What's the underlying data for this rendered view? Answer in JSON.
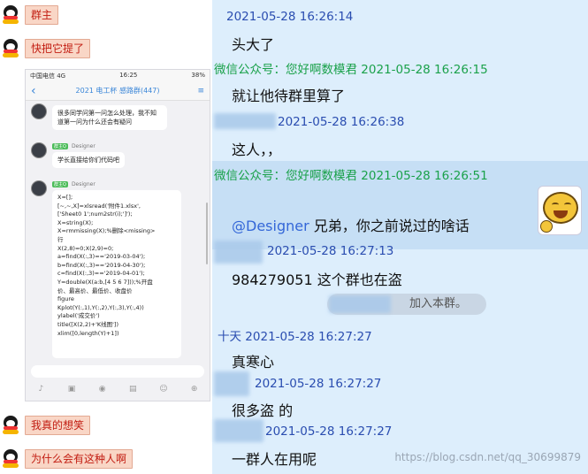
{
  "left_chat": {
    "messages": [
      {
        "text": "群主"
      },
      {
        "text": "快把它提了"
      },
      {
        "text": "我真的想笑"
      },
      {
        "text": "为什么会有这种人啊"
      }
    ]
  },
  "phone": {
    "status_left": "中国电信  4G",
    "status_time": "16:25",
    "status_right": "38%",
    "back": "‹",
    "title": "2021 电工杯 感路群(447)",
    "menu": "≡",
    "msg1": "很多同学问第一问怎么处理，我不知道第一问为什么还会有疑问",
    "msg2_tag": "群主Q",
    "msg2_name": "Designer",
    "msg2": "学长直接给你们代码吧",
    "msg3_tag": "群主Q",
    "msg3_name": "Designer",
    "code_lines": [
      "X=[];",
      "[~,~,X]=xlsread('附件1.xlsx',",
      "['Sheet0 1';num2str(i);']');",
      "X=string(X);",
      "X=rmmissing(X);%删除<missing>",
      "行",
      "X(2,8)=0;X(2,9)=0;",
      "a=find(X(:,3)=='2019-03-04');",
      "b=find(X(:,3)=='2019-04-30');",
      "c=find(X(:,3)=='2019-04-01');",
      "Y=double(X(a:b,[4 5 6 7]));%开盘",
      "价、最高价、最低价、收盘价",
      "figure",
      "Kplot(Y(:,1),Y(:,2),Y(:,3),Y(:,4))",
      "ylabel('成交价')",
      "title([X(2,2)+'K线图'])",
      "xlim([0,length(Y)+1])"
    ]
  },
  "right_chat": {
    "ts1": "2021-05-28 16:26:14",
    "msg1": "头大了",
    "ts2_name": "微信公众号：您好啊数模君",
    "ts2_time": "2021-05-28 16:26:15",
    "msg2": "就让他待群里算了",
    "ts3": "2021-05-28 16:26:38",
    "msg3": "这人，，",
    "ts4_name": "微信公众号：您好啊数模君",
    "ts4_time": "2021-05-28 16:26:51",
    "msg4_mention": "@Designer",
    "msg4": " 兄弟，你之前说过的啥话",
    "ts5": "2021-05-28 16:27:13",
    "msg5": "984279051 这个群也在盗",
    "joined": "加入本群。",
    "ts6_name": "十天",
    "ts6_time": "2021-05-28 16:27:27",
    "msg6": "真寒心",
    "ts7": "2021-05-28 16:27:27",
    "msg7": "很多盗 的",
    "ts8": "2021-05-28 16:27:27",
    "msg8": "一群人在用呢",
    "watermark": "https://blog.csdn.net/qq_30699879"
  },
  "colors": {
    "right_bg": "#ddeefc",
    "highlight_bg": "#c6dff5",
    "blue_name": "#2a4db0",
    "green_name": "#1aa14a",
    "qq_bubble": "#f9d6c6",
    "qq_text": "#c21d12"
  }
}
